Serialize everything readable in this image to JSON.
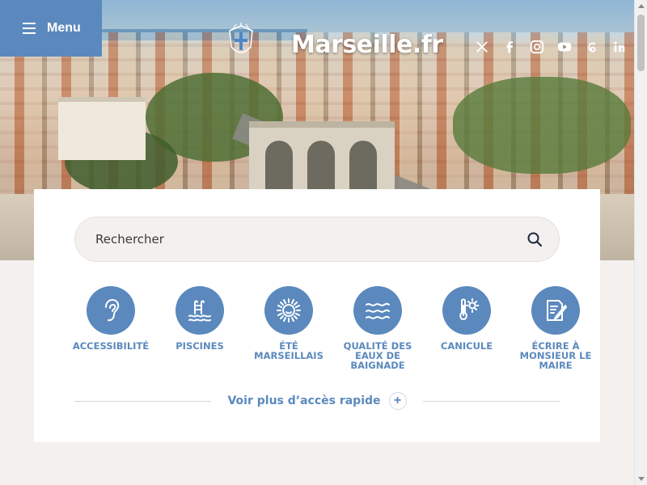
{
  "menu": {
    "label": "Menu"
  },
  "logo": {
    "text": "Marseille.fr"
  },
  "social": [
    {
      "name": "x",
      "icon": "x-icon"
    },
    {
      "name": "facebook",
      "icon": "facebook-icon"
    },
    {
      "name": "instagram",
      "icon": "instagram-icon"
    },
    {
      "name": "youtube",
      "icon": "youtube-icon"
    },
    {
      "name": "threads",
      "icon": "threads-icon"
    },
    {
      "name": "linkedin",
      "icon": "linkedin-icon"
    }
  ],
  "search": {
    "placeholder": "Rechercher"
  },
  "quick_access": [
    {
      "label": "ACCESSIBILITÉ",
      "icon": "ear-icon"
    },
    {
      "label": "PISCINES",
      "icon": "pool-icon"
    },
    {
      "label": "ÉTÉ MARSEILLAIS",
      "icon": "sun-icon"
    },
    {
      "label": "QUALITÉ DES EAUX DE BAIGNADE",
      "icon": "waves-icon"
    },
    {
      "label": "CANICULE",
      "icon": "thermometer-sun-icon"
    },
    {
      "label": "ÉCRIRE À MONSIEUR LE MAIRE",
      "icon": "write-letter-icon"
    }
  ],
  "more": {
    "label": "Voir plus d’accès rapide",
    "icon": "plus-icon"
  },
  "colors": {
    "accent": "#5b89bd",
    "background": "#f3f0ee",
    "card": "#ffffff"
  }
}
